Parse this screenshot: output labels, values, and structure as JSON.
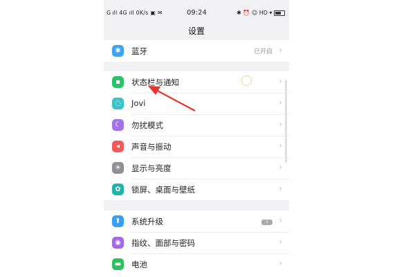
{
  "status_bar": {
    "left": "G ıll 4G ıll 0K/s ▣ ✉",
    "time": "09:24",
    "right": "✱ ⏰ ☺ HD ▾"
  },
  "header": {
    "title": "设置"
  },
  "groups": [
    {
      "items": [
        {
          "label": "蓝牙",
          "value": "已开启",
          "icon": "bluetooth-icon",
          "color": "#3ba4f3"
        }
      ]
    },
    {
      "items": [
        {
          "label": "状态栏与通知",
          "icon": "notification-icon",
          "color": "#27c46a"
        },
        {
          "label": "Jovi",
          "icon": "jovi-icon",
          "color": "#3bc3c9"
        },
        {
          "label": "勿扰模式",
          "icon": "moon-icon",
          "color": "#a573e8"
        },
        {
          "label": "声音与振动",
          "icon": "speaker-icon",
          "color": "#f25a5a"
        },
        {
          "label": "显示与亮度",
          "icon": "brightness-icon",
          "color": "#8f8f95"
        },
        {
          "label": "锁屏、桌面与壁纸",
          "icon": "wallpaper-icon",
          "color": "#22b3a8"
        }
      ]
    },
    {
      "items": [
        {
          "label": "系统升级",
          "badge": "1",
          "icon": "update-icon",
          "color": "#3a9ef5"
        },
        {
          "label": "指纹、面部与密码",
          "icon": "fingerprint-icon",
          "color": "#a368e6"
        },
        {
          "label": "电池",
          "icon": "battery-icon",
          "color": "#2dc25f"
        }
      ]
    }
  ]
}
